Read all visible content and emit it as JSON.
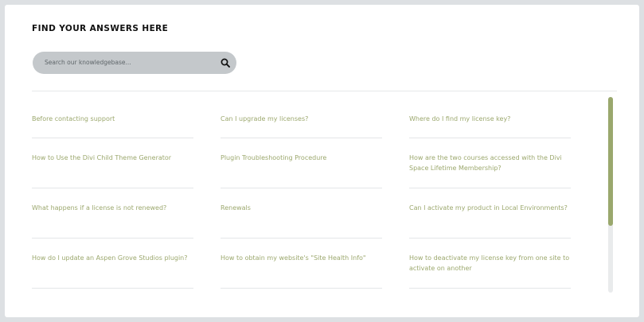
{
  "heading": "FIND YOUR ANSWERS HERE",
  "search": {
    "placeholder": "Search our knowledgebase...",
    "icon": "search-icon"
  },
  "faq": {
    "items": [
      "Before contacting support",
      "Can I upgrade my licenses?",
      "Where do I find my license key?",
      "How to Use the Divi Child Theme Generator",
      "Plugin Troubleshooting Procedure",
      "How are the two courses accessed with the Divi Space Lifetime Membership?",
      "What happens if a license is not renewed?",
      "Renewals",
      "Can I activate my product in Local Environments?",
      "How do I update an Aspen Grove Studios plugin?",
      "How to obtain my website's \"Site Health Info\"",
      "How to deactivate my license key from one site to activate on another"
    ]
  },
  "colors": {
    "link": "#9ca86e",
    "scroll_thumb": "#9aa86d",
    "search_bg": "#c4c8cb"
  },
  "scroll_position": 0.66
}
